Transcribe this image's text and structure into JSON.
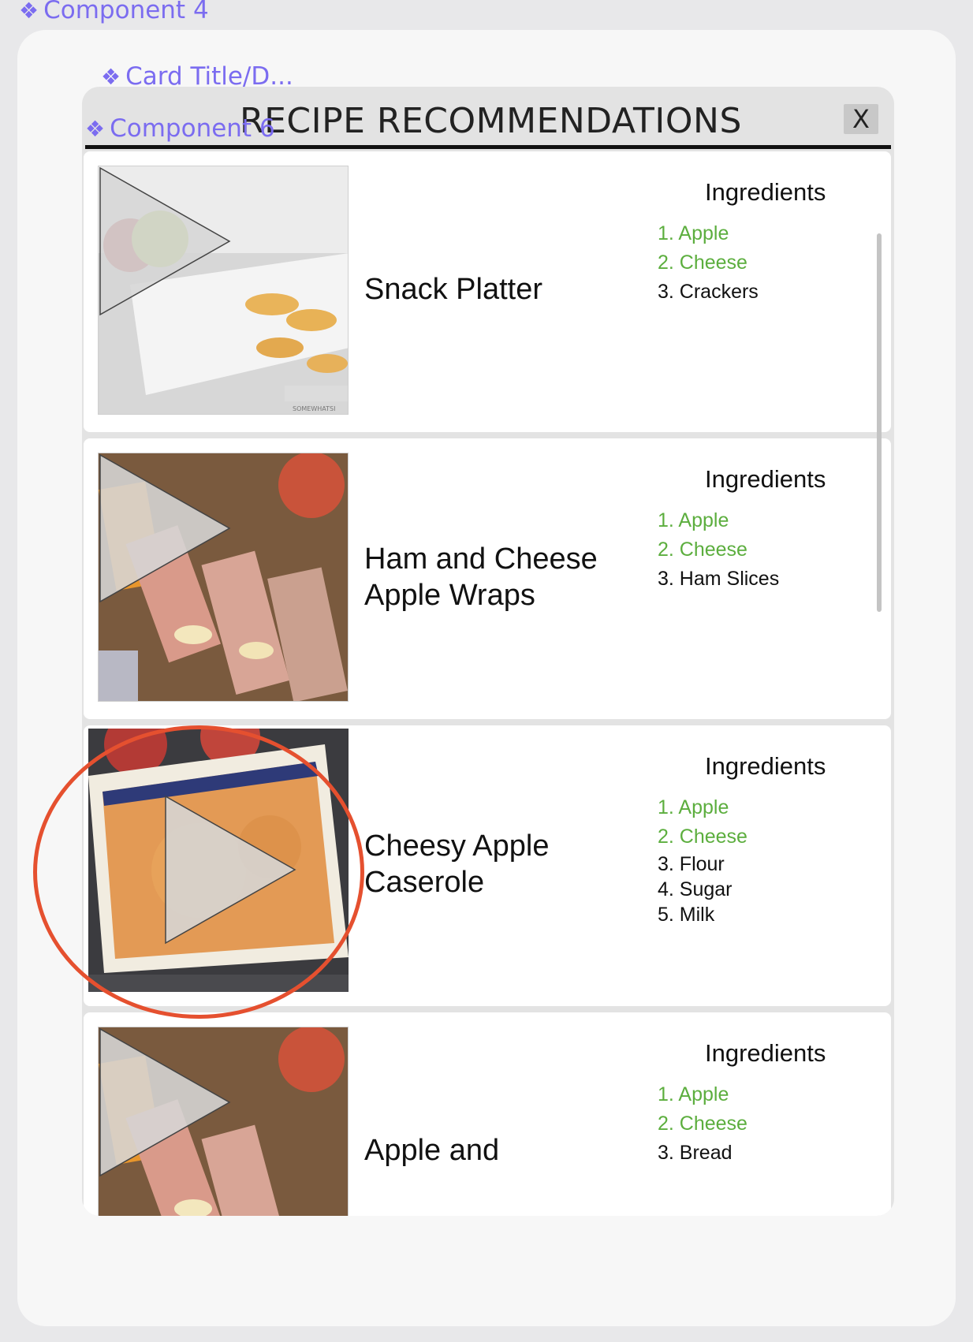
{
  "labels": {
    "component4": "Component 4",
    "card_title": "Card Title/D...",
    "component6": "Component 6"
  },
  "panel": {
    "title": "RECIPE RECOMMENDATIONS",
    "close_label": "X"
  },
  "colors": {
    "label_purple": "#7b6cf0",
    "matched_ingredient": "#5cae3e",
    "annotation_red": "#e5502f"
  },
  "recipes": [
    {
      "name": "Snack Platter",
      "ingredients_heading": "Ingredients",
      "ingredients": [
        "1. Apple",
        "2. Cheese",
        "3. Crackers"
      ],
      "image_watermark": "SOMEWHATSI"
    },
    {
      "name": "Ham and Cheese Apple Wraps",
      "ingredients_heading": "Ingredients",
      "ingredients": [
        "1. Apple",
        "2. Cheese",
        "3. Ham Slices"
      ]
    },
    {
      "name": "Cheesy Apple Caserole",
      "ingredients_heading": "Ingredients",
      "ingredients": [
        "1. Apple",
        "2. Cheese",
        "3. Flour",
        "4. Sugar",
        "5. Milk"
      ]
    },
    {
      "name": "Apple and",
      "ingredients_heading": "Ingredients",
      "ingredients": [
        "1. Apple",
        "2. Cheese",
        "3. Bread"
      ]
    }
  ]
}
